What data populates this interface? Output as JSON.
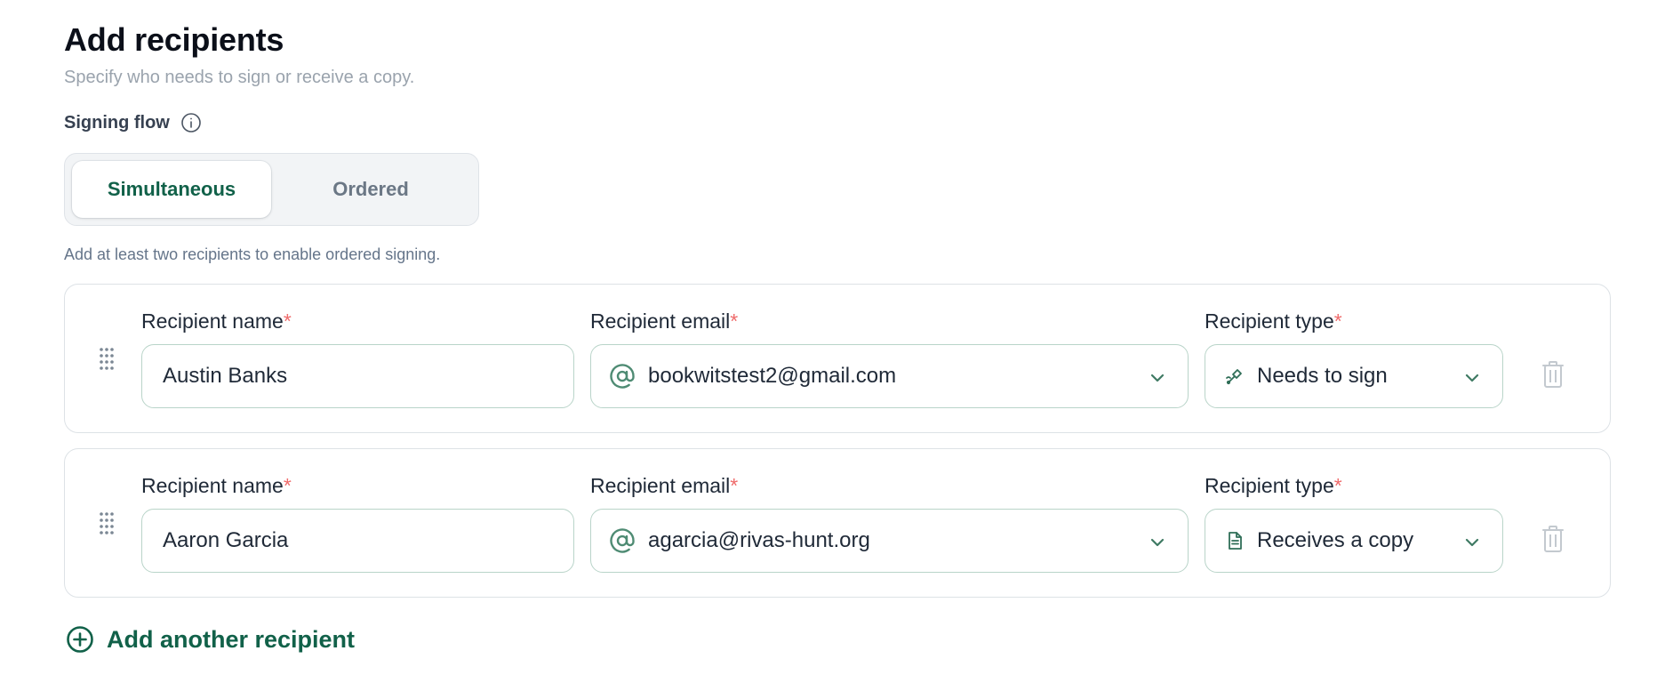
{
  "header": {
    "title": "Add recipients",
    "subtitle": "Specify who needs to sign or receive a copy."
  },
  "signing_flow": {
    "label": "Signing flow",
    "info_icon": "info-circle-icon",
    "options": [
      {
        "label": "Simultaneous",
        "selected": true
      },
      {
        "label": "Ordered",
        "selected": false
      }
    ],
    "hint": "Add at least two recipients to enable ordered signing."
  },
  "labels": {
    "name": "Recipient name",
    "email": "Recipient email",
    "type": "Recipient type",
    "required_marker": "*"
  },
  "recipients": [
    {
      "name": "Austin Banks",
      "email": "bookwitstest2@gmail.com",
      "type": "Needs to sign",
      "type_icon": "pen-nib-icon"
    },
    {
      "name": "Aaron Garcia",
      "email": "agarcia@rivas-hunt.org",
      "type": "Receives a copy",
      "type_icon": "document-icon"
    }
  ],
  "add_button": {
    "label": "Add another recipient",
    "icon": "plus-circle-icon"
  },
  "colors": {
    "brand": "#116149",
    "required": "#ef6b6b",
    "input_border": "#b9d4c9",
    "muted_text": "#9aa3ad"
  }
}
